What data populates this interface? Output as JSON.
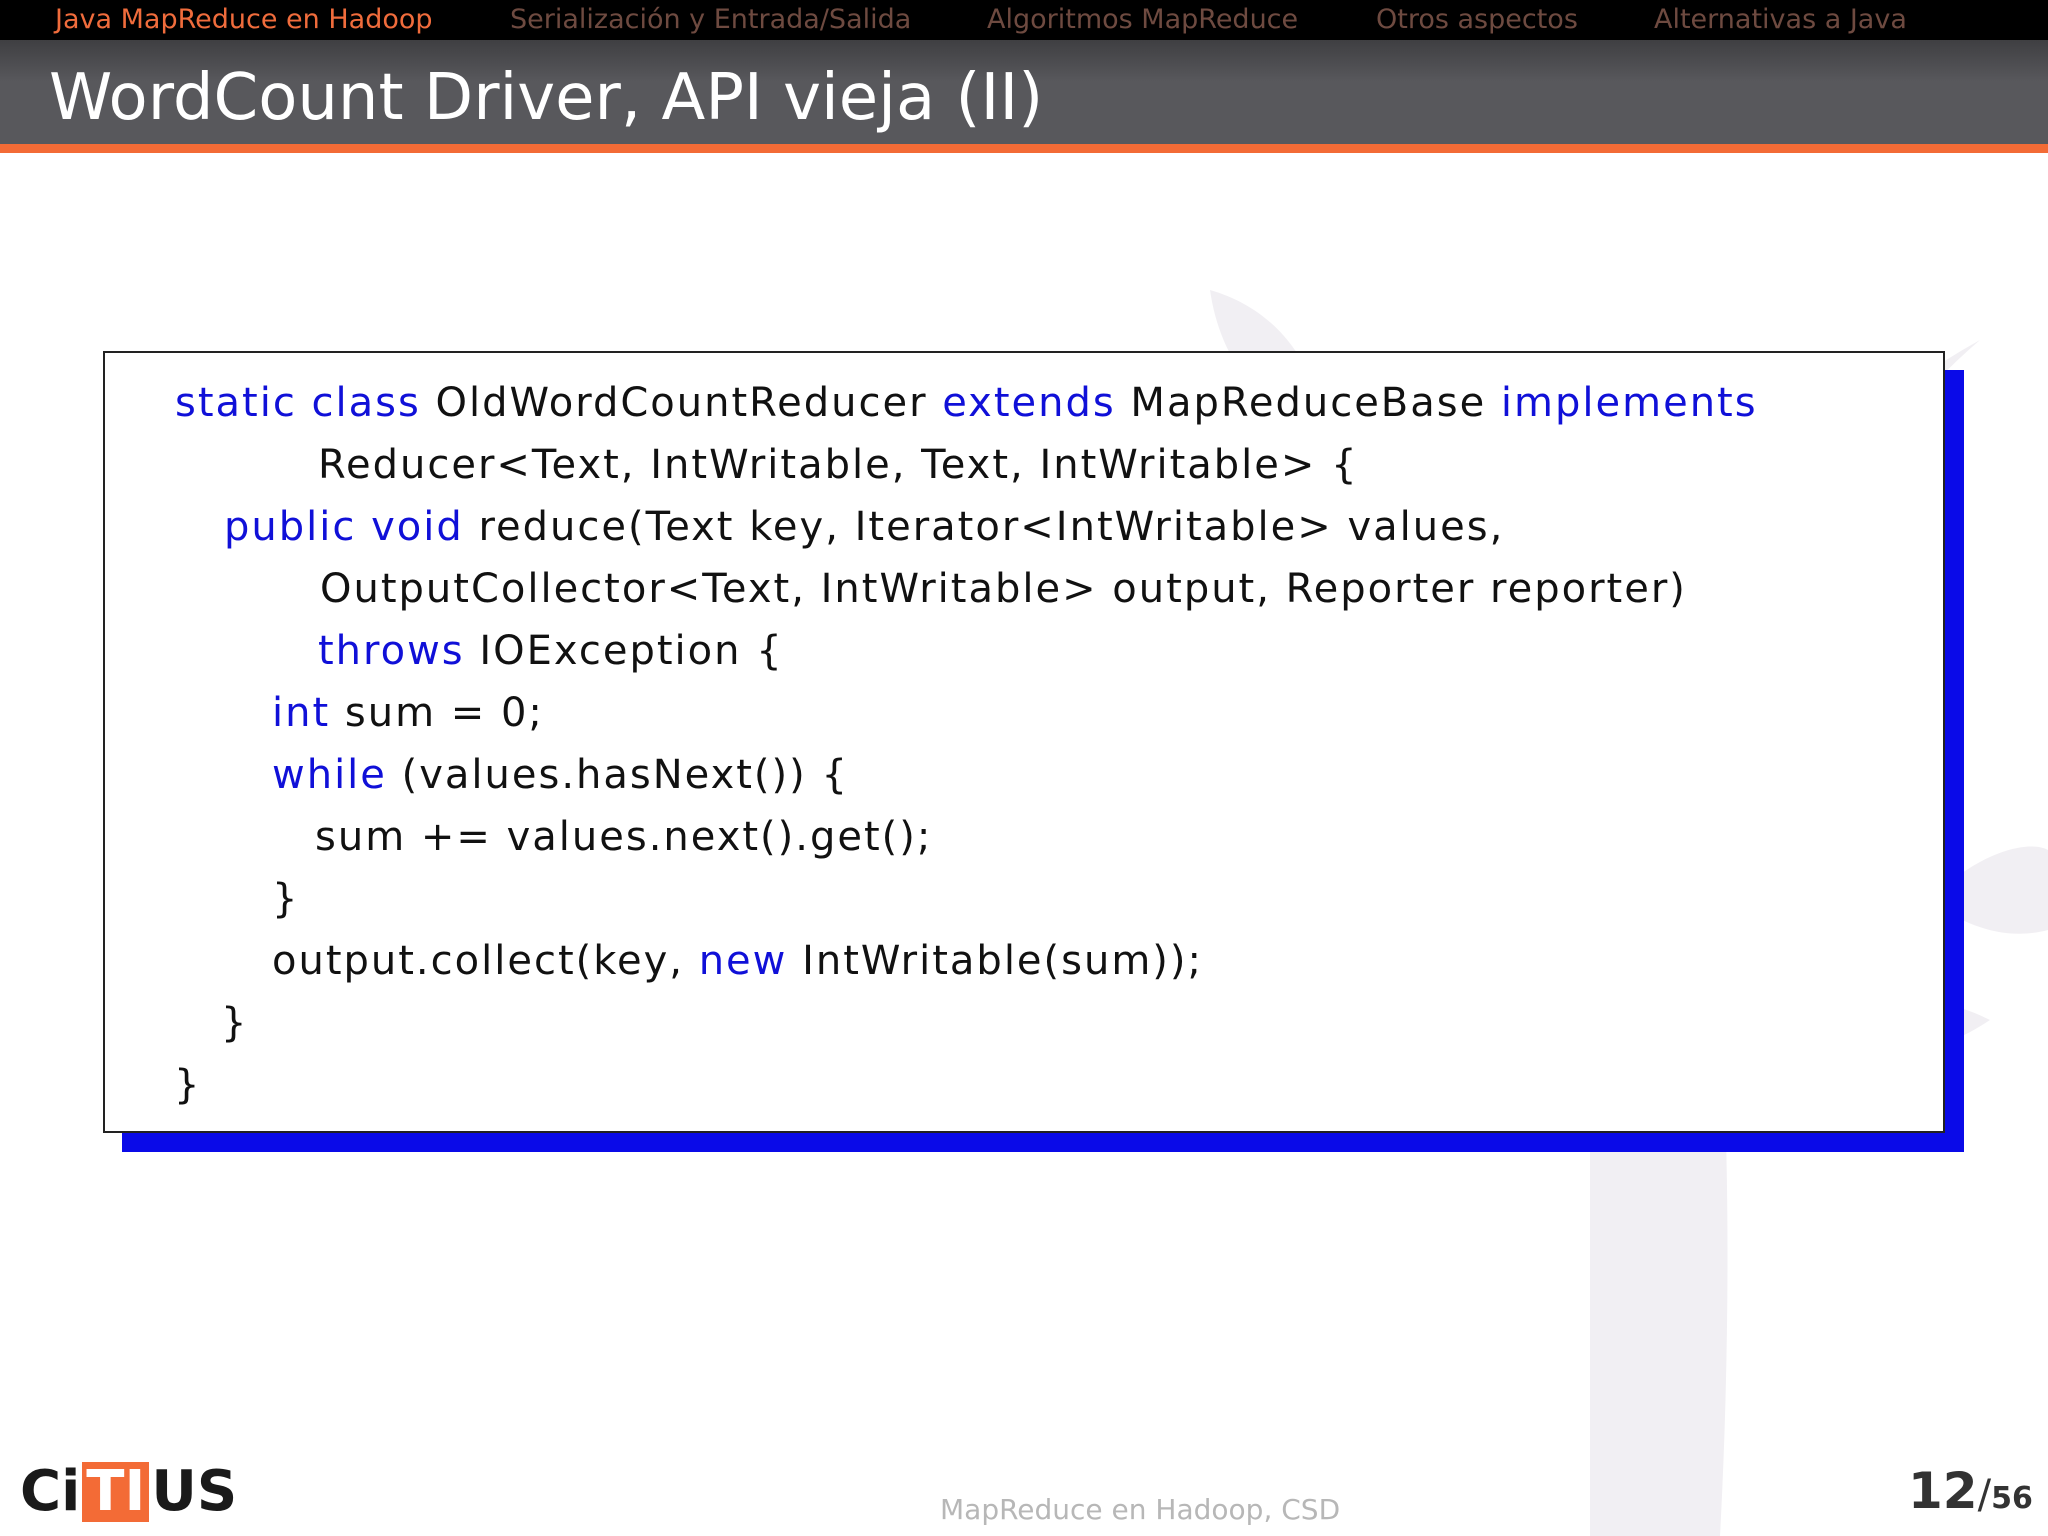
{
  "nav": {
    "items": [
      {
        "label": "Java MapReduce en Hadoop",
        "active": true
      },
      {
        "label": "Serialización y Entrada/Salida",
        "active": false
      },
      {
        "label": "Algoritmos MapReduce",
        "active": false
      },
      {
        "label": "Otros aspectos",
        "active": false
      },
      {
        "label": "Alternativas a Java",
        "active": false
      }
    ]
  },
  "slide": {
    "title": "WordCount Driver, API vieja (II)"
  },
  "code": {
    "lines": [
      [
        {
          "t": "static",
          "k": true
        },
        {
          "t": " "
        },
        {
          "t": "class",
          "k": true
        },
        {
          "t": " OldWordCountReducer "
        },
        {
          "t": "extends",
          "k": true
        },
        {
          "t": " MapReduceBase "
        },
        {
          "t": "implements",
          "k": true
        }
      ],
      [
        {
          "t": "Reducer<Text, IntWritable, Text, IntWritable> {"
        }
      ],
      [
        {
          "t": "public",
          "k": true
        },
        {
          "t": " "
        },
        {
          "t": "void",
          "k": true
        },
        {
          "t": " reduce(Text key, Iterator<IntWritable> values,"
        }
      ],
      [
        {
          "t": "OutputCollector<Text, IntWritable> output, Reporter reporter)"
        }
      ],
      [
        {
          "t": "throws",
          "k": true
        },
        {
          "t": " IOException {"
        }
      ],
      [
        {
          "t": "int",
          "k": true
        },
        {
          "t": " sum = 0;"
        }
      ],
      [
        {
          "t": "while",
          "k": true
        },
        {
          "t": " (values.hasNext()) {"
        }
      ],
      [
        {
          "t": "sum += values.next().get();"
        }
      ],
      [
        {
          "t": "}"
        }
      ],
      [
        {
          "t": "output.collect(key, "
        },
        {
          "t": "new",
          "k": true
        },
        {
          "t": " IntWritable(sum));"
        }
      ],
      [
        {
          "t": "}"
        }
      ],
      [
        {
          "t": "}"
        }
      ]
    ]
  },
  "footer": {
    "logo_parts": [
      "Ci",
      "TI",
      "US"
    ],
    "text": "MapReduce en Hadoop, CSD",
    "page_current": "12",
    "page_separator": "/",
    "page_total": "56"
  },
  "colors": {
    "accent": "#f36b36",
    "keyword": "#1010d8",
    "box_shadow": "#0a0ae8"
  }
}
